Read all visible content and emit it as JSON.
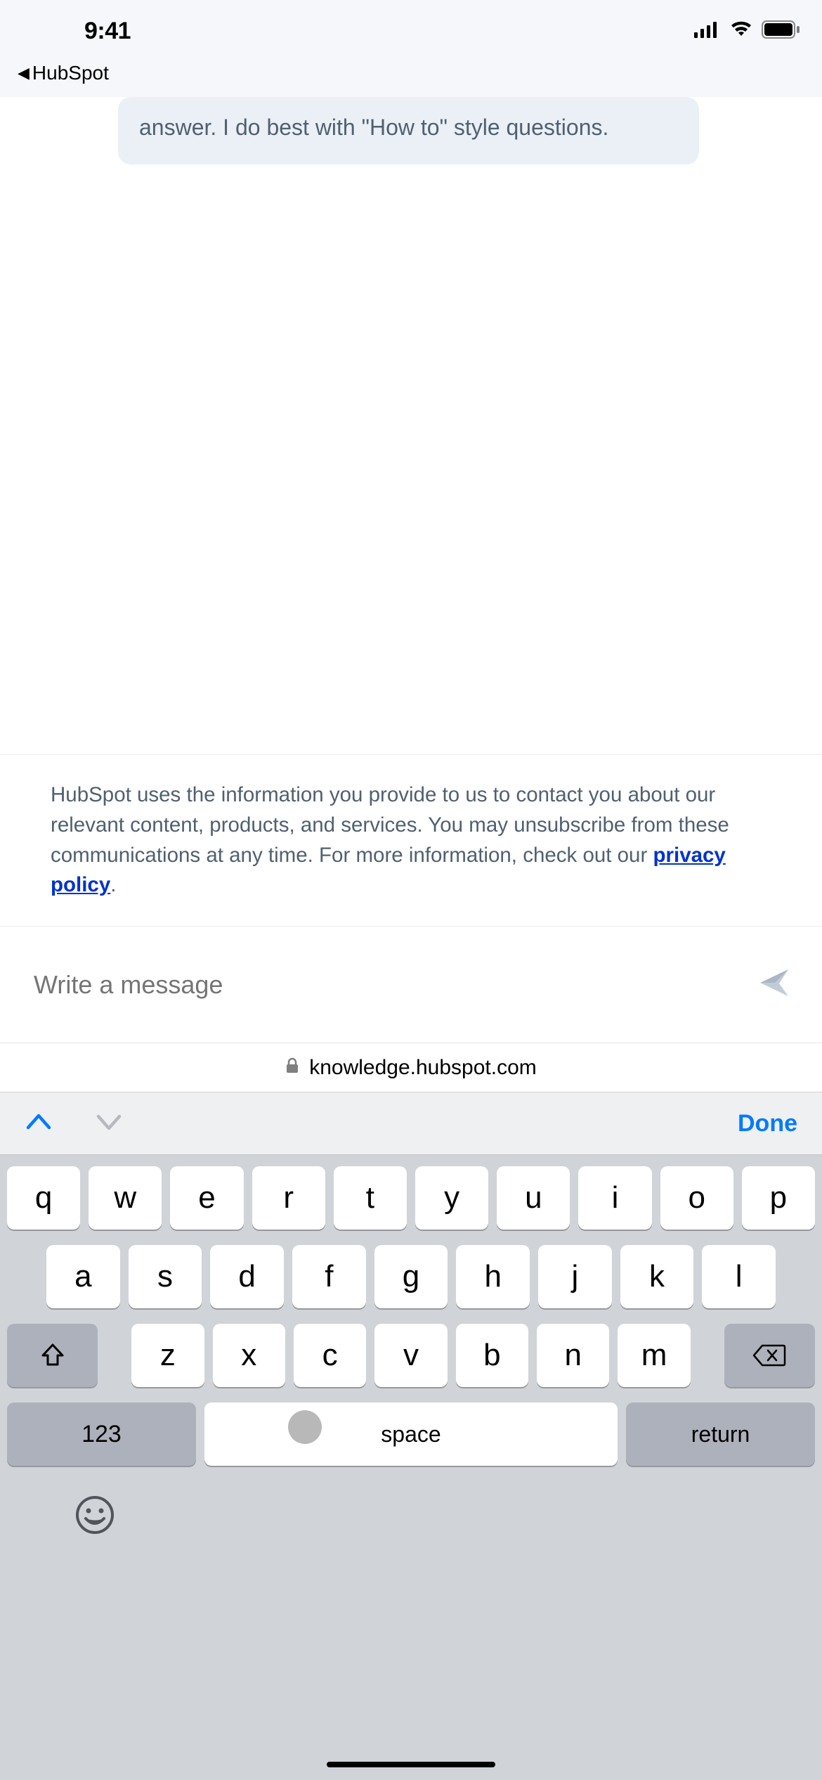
{
  "status": {
    "time": "9:41"
  },
  "breadcrumb": {
    "label": "HubSpot"
  },
  "chat": {
    "bubble_text": "answer. I do best with \"How to\" style questions."
  },
  "disclosure": {
    "text_before": "HubSpot uses the information you provide to us to contact you about our relevant content, products, and services. You may unsubscribe from these communications at any time. For more information, check out our ",
    "link_text": "privacy policy",
    "text_after": "."
  },
  "composer": {
    "placeholder": "Write a message"
  },
  "address": {
    "url": "knowledge.hubspot.com"
  },
  "keyboard_accessory": {
    "done": "Done"
  },
  "keyboard": {
    "row1": [
      "q",
      "w",
      "e",
      "r",
      "t",
      "y",
      "u",
      "i",
      "o",
      "p"
    ],
    "row2": [
      "a",
      "s",
      "d",
      "f",
      "g",
      "h",
      "j",
      "k",
      "l"
    ],
    "row3": [
      "z",
      "x",
      "c",
      "v",
      "b",
      "n",
      "m"
    ],
    "num": "123",
    "space": "space",
    "return": "return"
  }
}
